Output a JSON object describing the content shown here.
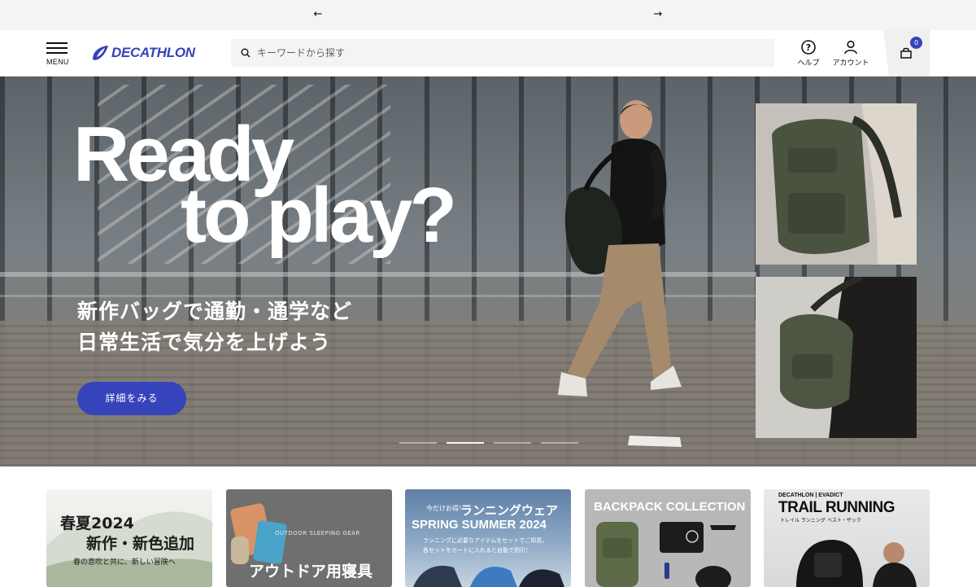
{
  "promo": {
    "prev_icon": "arrow-left-icon",
    "next_icon": "arrow-right-icon"
  },
  "header": {
    "menu_label": "MENU",
    "logo_text": "DECATHLON",
    "search_placeholder": "キーワードから探す",
    "help_label": "ヘルプ",
    "account_label": "アカウント",
    "cart_count": "0"
  },
  "colors": {
    "brand": "#3643ba",
    "promo_bg": "#f5f4f5"
  },
  "hero": {
    "headline_line1": "Ready",
    "headline_line2": "to play?",
    "subcopy_line1": "新作バッグで通勤・通学など",
    "subcopy_line2": "日常生活で気分を上げよう",
    "cta_label": "詳細をみる",
    "slide_count": 4,
    "active_slide": 2
  },
  "cards": [
    {
      "title_line1": "春夏2024",
      "title_line2": "新作・新色追加",
      "caption": "春の息吹と共に、新しい冒険へ"
    },
    {
      "tag": "OUTDOOR SLEEPING GEAR",
      "title": "アウトドア用寝具"
    },
    {
      "kicker": "今だけお得！",
      "title_jp": "ランニングウェア",
      "title_en": "SPRING SUMMER 2024",
      "line1": "ランニングに必要なアイテムをセットでご用意。",
      "line2": "各セットをカートに入れると自動で割引！"
    },
    {
      "title": "BACKPACK COLLECTION"
    },
    {
      "brand_line": "DECATHLON | EVADICT",
      "title": "TRAIL RUNNING",
      "subtitle": "トレイル ランニング ベスト・ザック"
    }
  ]
}
